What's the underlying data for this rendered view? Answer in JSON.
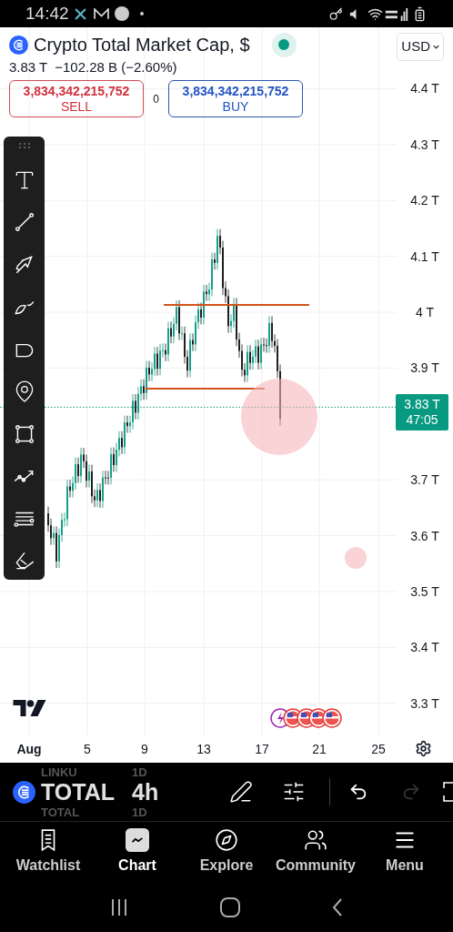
{
  "status_bar": {
    "time": "14:42"
  },
  "header": {
    "title": "Crypto Total Market Cap, $",
    "market_open": true,
    "currency": "USD",
    "price": "3.83 T",
    "change": "−102.28 B (−2.60%)",
    "sell": {
      "price": "3,834,342,215,752",
      "label": "SELL"
    },
    "spread": "0",
    "buy": {
      "price": "3,834,342,215,752",
      "label": "BUY"
    }
  },
  "chart": {
    "price_axis": [
      "4.4 T",
      "4.3 T",
      "4.2 T",
      "4.1 T",
      "4 T",
      "3.9 T",
      "3.7 T",
      "3.6 T",
      "3.5 T",
      "3.4 T",
      "3.3 T"
    ],
    "time_axis": [
      "Aug",
      "5",
      "9",
      "13",
      "17",
      "21",
      "25"
    ],
    "last_price": "3.83 T",
    "countdown": "47:05"
  },
  "symbol_bar": {
    "previous": {
      "symbol": "LINKU",
      "interval": "1D"
    },
    "current": {
      "symbol": "TOTAL",
      "interval": "4h"
    },
    "next": {
      "symbol": "TOTAL",
      "interval": "1D"
    },
    "redo_disabled": true
  },
  "nav": [
    {
      "label": "Watchlist",
      "selected": false
    },
    {
      "label": "Chart",
      "selected": true
    },
    {
      "label": "Explore",
      "selected": false
    },
    {
      "label": "Community",
      "selected": false
    },
    {
      "label": "Menu",
      "selected": false
    }
  ]
}
